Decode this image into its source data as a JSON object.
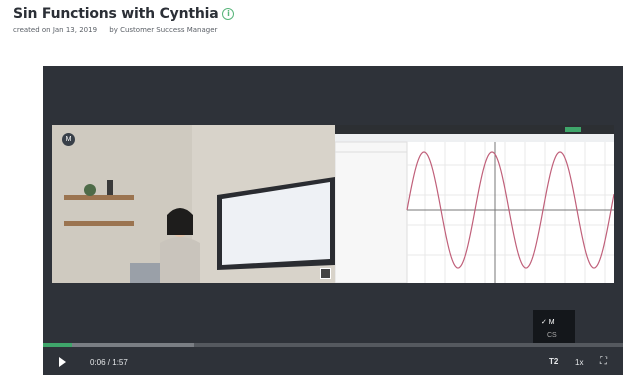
{
  "header": {
    "title": "Sin Functions with Cynthia",
    "created": "created on Jan 13, 2019",
    "author": "by Customer Success Manager"
  },
  "player": {
    "cam_badge": "M",
    "time": "0:06 / 1:57",
    "cc_label": "T2",
    "speed_label": "1x",
    "fullscreen_glyph": "⛶",
    "progress_fraction": 0.05,
    "buffered_fraction": 0.26,
    "caption_menu": {
      "selected": "✓ M",
      "option": "CS"
    }
  },
  "colors": {
    "accent": "#3fa66b",
    "player_bg": "#2e3239"
  }
}
